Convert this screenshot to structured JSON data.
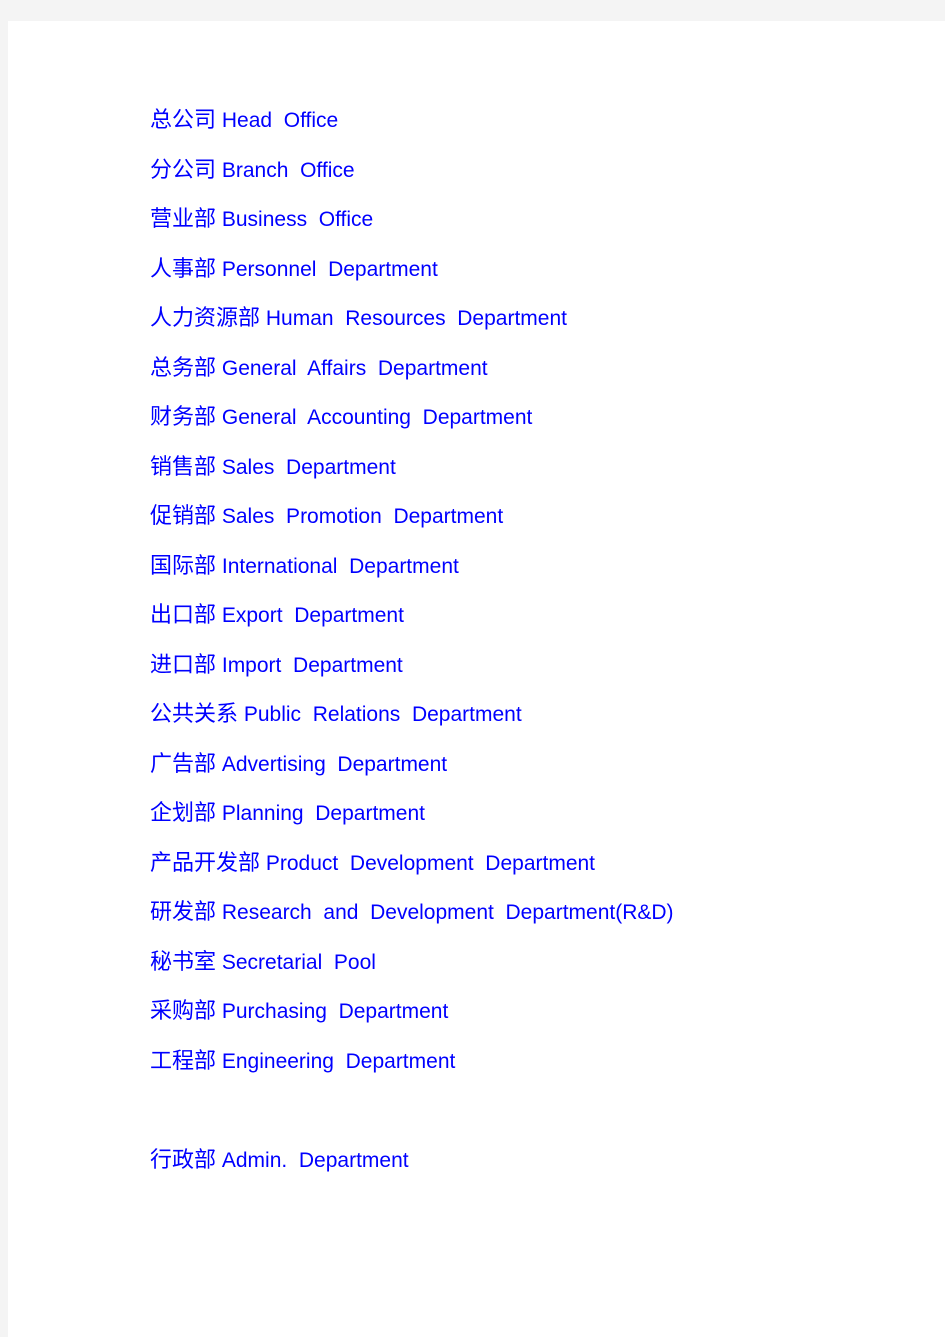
{
  "document": {
    "page_background": "#ffffff",
    "canvas_background": "#f4f4f4",
    "text_color": "#0000ff",
    "lines": [
      {
        "cn": "总公司",
        "en": "Head  Office"
      },
      {
        "cn": "分公司",
        "en": "Branch  Office"
      },
      {
        "cn": "营业部",
        "en": "Business  Office"
      },
      {
        "cn": "人事部",
        "en": "Personnel  Department"
      },
      {
        "cn": "人力资源部",
        "en": "Human  Resources  Department"
      },
      {
        "cn": "总务部",
        "en": "General  Affairs  Department"
      },
      {
        "cn": "财务部",
        "en": "General  Accounting  Department"
      },
      {
        "cn": "销售部",
        "en": "Sales  Department"
      },
      {
        "cn": "促销部",
        "en": "Sales  Promotion  Department"
      },
      {
        "cn": "国际部",
        "en": "International  Department"
      },
      {
        "cn": "出口部",
        "en": "Export  Department"
      },
      {
        "cn": "进口部",
        "en": "Import  Department"
      },
      {
        "cn": "公共关系",
        "en": "Public  Relations  Department"
      },
      {
        "cn": "广告部",
        "en": "Advertising  Department"
      },
      {
        "cn": "企划部",
        "en": "Planning  Department"
      },
      {
        "cn": "产品开发部",
        "en": "Product  Development  Department"
      },
      {
        "cn": "研发部",
        "en": "Research  and  Development  Department(R&D)"
      },
      {
        "cn": "秘书室",
        "en": "Secretarial  Pool"
      },
      {
        "cn": "采购部",
        "en": "Purchasing  Department"
      },
      {
        "cn": "工程部",
        "en": "Engineering  Department"
      },
      {
        "cn": "",
        "en": ""
      },
      {
        "cn": "行政部",
        "en": "Admin.  Department"
      }
    ]
  }
}
